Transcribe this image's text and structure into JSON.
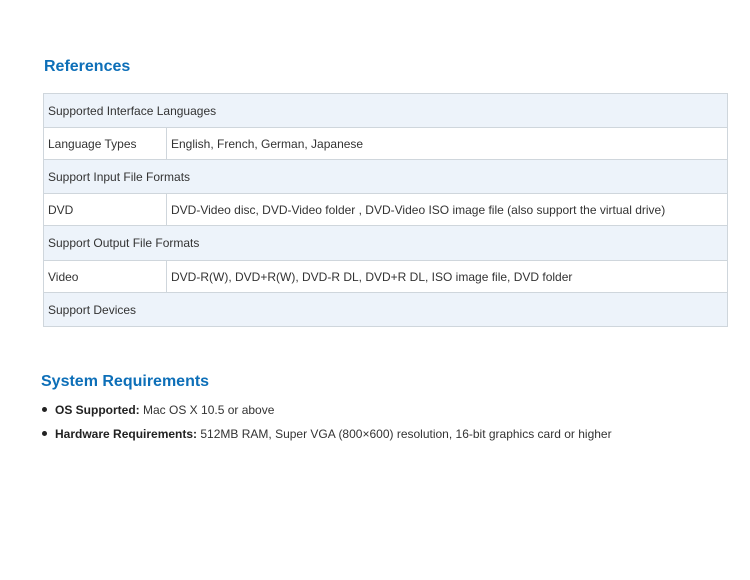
{
  "references": {
    "title": "References",
    "rows": [
      {
        "type": "section",
        "text": "Supported Interface Languages"
      },
      {
        "type": "row",
        "label": "Language Types",
        "value": "English, French, German, Japanese"
      },
      {
        "type": "section",
        "text": "Support Input File Formats"
      },
      {
        "type": "row",
        "label": "DVD",
        "value": "DVD-Video disc, DVD-Video folder , DVD-Video ISO image file (also support the virtual drive)"
      },
      {
        "type": "section",
        "text": "Support Output File Formats"
      },
      {
        "type": "row",
        "label": "Video",
        "value": "DVD-R(W), DVD+R(W), DVD-R DL, DVD+R DL, ISO image file, DVD folder"
      },
      {
        "type": "section",
        "text": "Support Devices"
      }
    ]
  },
  "system_requirements": {
    "title": "System Requirements",
    "items": [
      {
        "term": "OS Supported:",
        "value": " Mac OS X 10.5 or above"
      },
      {
        "term": "Hardware Requirements:",
        "value": " 512MB RAM, Super VGA (800×600) resolution, 16-bit graphics card or higher"
      }
    ]
  }
}
